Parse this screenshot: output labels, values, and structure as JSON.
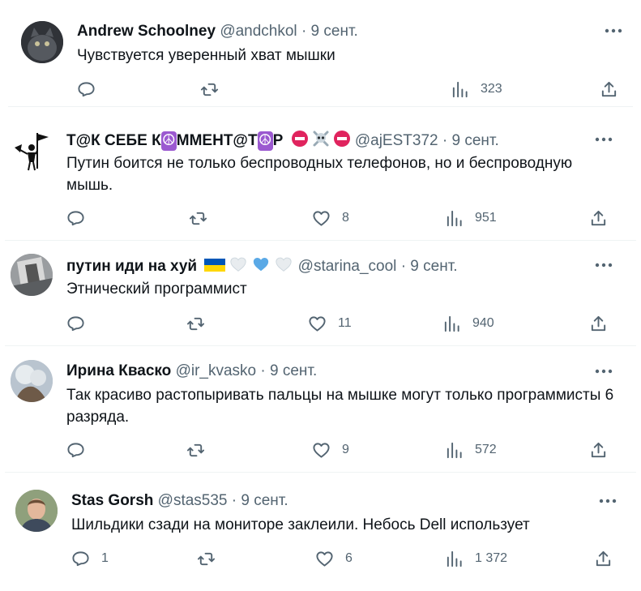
{
  "tweets": [
    {
      "name": "Andrew Schoolney",
      "handle": "@andchkol",
      "date": "9 сент.",
      "text": "Чувствуется уверенный хват мышки",
      "replies": "",
      "retweets": "",
      "likes": "",
      "views": "323"
    },
    {
      "name": "Т@К СЕБЕ К☮ММЕНТ@Т☮Р",
      "handle": "@ajEST372",
      "date": "9 сент.",
      "text": "Путин боится не только беспроводных телефонов, но и беспроводную мышь.",
      "replies": "",
      "retweets": "",
      "likes": "8",
      "views": "951"
    },
    {
      "name": "путин иди на хуй",
      "handle": "@starina_cool",
      "date": "9 сент.",
      "text": "Этнический программист",
      "replies": "",
      "retweets": "",
      "likes": "11",
      "views": "940"
    },
    {
      "name": "Ирина Кваско",
      "handle": "@ir_kvasko",
      "date": "9 сент.",
      "text": "Так красиво растопыривать пальцы на мышке могут только программисты 6 разряда.",
      "replies": "",
      "retweets": "",
      "likes": "9",
      "views": "572"
    },
    {
      "name": "Stas Gorsh",
      "handle": "@stas535",
      "date": "9 сент.",
      "text": "Шильдики сзади на мониторе заклеили. Небось Dell использует",
      "replies": "1",
      "retweets": "",
      "likes": "6",
      "views": "1 372"
    }
  ],
  "separator": "·",
  "colors": {
    "text": "#0f1419",
    "secondary": "#536471",
    "divider": "#eff3f4",
    "peace_purple": "#9b59d0",
    "flag_blue": "#0057b7",
    "flag_yellow": "#ffd700",
    "heart_blue": "#5aa9e6"
  },
  "icons": [
    "reply-icon",
    "retweet-icon",
    "like-icon",
    "views-icon",
    "share-icon",
    "more-icon"
  ]
}
